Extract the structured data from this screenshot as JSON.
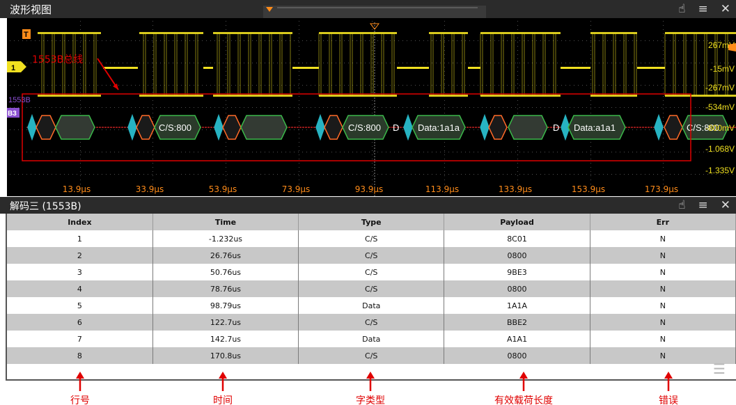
{
  "waveform_panel": {
    "title": "波形视图",
    "icons": [
      "touch-lock-icon",
      "menu-icon",
      "close-icon"
    ],
    "trigger_marker": "T",
    "channel1_label": "1",
    "bus_label": "B3",
    "bus_name": "1553B",
    "annotation_label": "1553B总线",
    "voltage_labels": [
      "267mV",
      "-15mV",
      "-267mV",
      "-534mV",
      "-800mV",
      "-1.068V",
      "-1.335V"
    ],
    "time_labels": [
      "13.9µs",
      "33.9µs",
      "53.9µs",
      "73.9µs",
      "93.9µs",
      "113.9µs",
      "133.9µs",
      "153.9µs",
      "173.9µs"
    ],
    "decode_words": [
      "C/S:800",
      "C/S:800",
      "D",
      "Data:1a1a",
      "D",
      "Data:a1a1",
      "C/S:800"
    ],
    "colors": {
      "channel1": "#f0e020",
      "bus": "#8a4fd0",
      "scale": "#ff8c1a",
      "annotation": "#e00000",
      "word_fill": "#2a3a2a",
      "word_border": "#3bb84a",
      "sync_border": "#ff6a28",
      "cyan_marker": "#27b3c2"
    }
  },
  "decode_panel": {
    "title": "解码三 (1553B)",
    "columns": [
      "Index",
      "Time",
      "Type",
      "Payload",
      "Err"
    ],
    "rows": [
      [
        "1",
        "-1.232us",
        "C/S",
        "8C01",
        "N"
      ],
      [
        "2",
        "26.76us",
        "C/S",
        "0800",
        "N"
      ],
      [
        "3",
        "50.76us",
        "C/S",
        "9BE3",
        "N"
      ],
      [
        "4",
        "78.76us",
        "C/S",
        "0800",
        "N"
      ],
      [
        "5",
        "98.79us",
        "Data",
        "1A1A",
        "N"
      ],
      [
        "6",
        "122.7us",
        "C/S",
        "BBE2",
        "N"
      ],
      [
        "7",
        "142.7us",
        "Data",
        "A1A1",
        "N"
      ],
      [
        "8",
        "170.8us",
        "C/S",
        "0800",
        "N"
      ]
    ]
  },
  "annotations": {
    "labels": [
      "行号",
      "时间",
      "字类型",
      "有效载荷长度",
      "错误"
    ]
  }
}
